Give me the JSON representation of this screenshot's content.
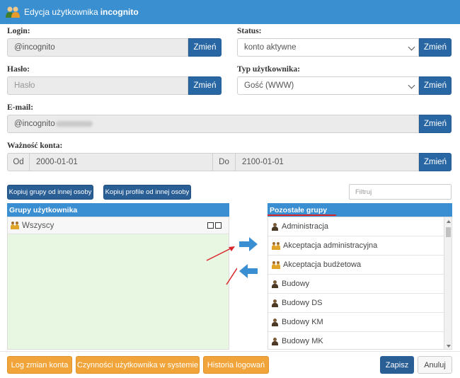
{
  "window": {
    "title_prefix": "Edycja użytkownika",
    "title_user": "incognito"
  },
  "form": {
    "login": {
      "label": "Login:",
      "value": "@incognito",
      "button": "Zmień"
    },
    "status": {
      "label": "Status:",
      "value": "konto aktywne",
      "button": "Zmień"
    },
    "password": {
      "label": "Hasło:",
      "placeholder": "Hasło",
      "button": "Zmień"
    },
    "user_type": {
      "label": "Typ użytkownika:",
      "value": "Gość (WWW)",
      "button": "Zmień"
    },
    "email": {
      "label": "E-mail:",
      "value": "@incognito",
      "button": "Zmień"
    },
    "validity": {
      "label": "Ważność konta:",
      "from_label": "Od",
      "from_value": "2000-01-01",
      "to_label": "Do",
      "to_value": "2100-01-01",
      "button": "Zmień"
    }
  },
  "toolbar": {
    "copy_groups": "Kopiuj grupy od innej osoby",
    "copy_profiles": "Kopiuj profile od innej osoby",
    "filter_placeholder": "Filtruj"
  },
  "user_groups": {
    "title": "Grupy użytkownika",
    "items": [
      {
        "label": "Wszyscy",
        "icon": "users-group-icon"
      }
    ]
  },
  "other_groups": {
    "title": "Pozostałe grupy",
    "items": [
      {
        "label": "Administracja",
        "icon": "user-icon"
      },
      {
        "label": "Akceptacja administracyjna",
        "icon": "users-group-icon"
      },
      {
        "label": "Akceptacja budżetowa",
        "icon": "users-group-icon"
      },
      {
        "label": "Budowy",
        "icon": "user-icon"
      },
      {
        "label": "Budowy DS",
        "icon": "user-icon"
      },
      {
        "label": "Budowy KM",
        "icon": "user-icon"
      },
      {
        "label": "Budowy MK",
        "icon": "user-icon"
      }
    ]
  },
  "footer": {
    "log_button": "Log zmian konta",
    "activity_button": "Czynności użytkownika w systemie",
    "login_history_button": "Historia logowań",
    "save_button": "Zapisz",
    "cancel_button": "Anuluj"
  },
  "colors": {
    "titlebar": "#3a8fd0",
    "primary": "#2867a4",
    "orange": "#f0a43a",
    "annotation": "#d9262a",
    "group_bg": "#e8f7e1"
  }
}
